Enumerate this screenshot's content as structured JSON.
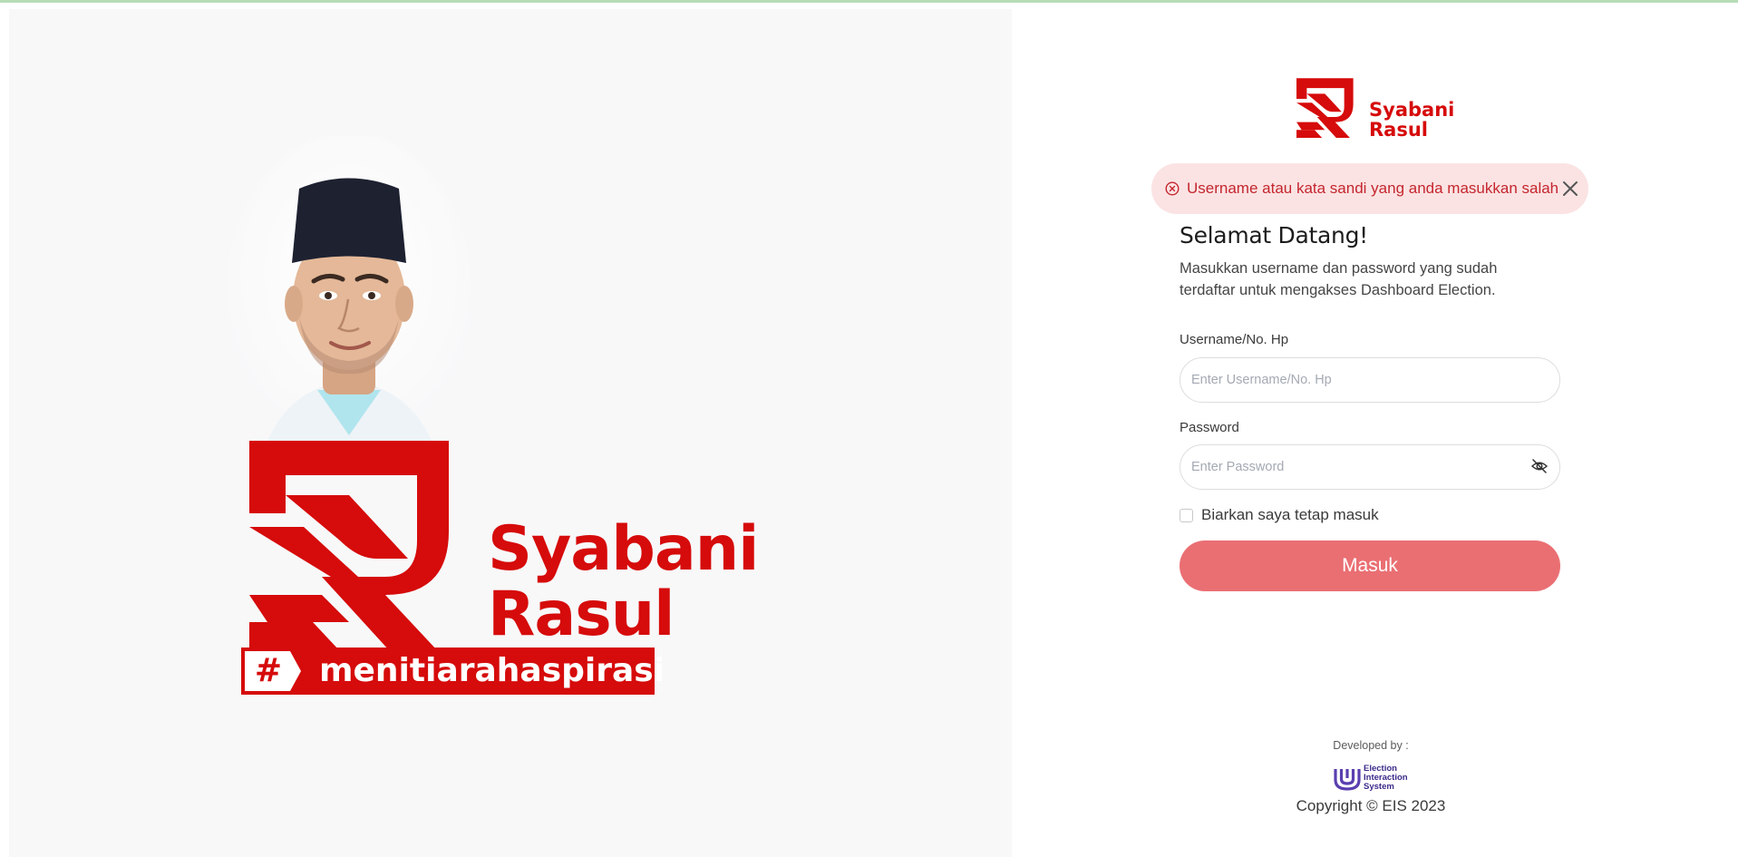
{
  "hero": {
    "name_line1": "Syabani",
    "name_line2": "Rasul",
    "hash_symbol": "#",
    "hashtag": "menitiarahaspirasi",
    "icon": "candidate-portrait"
  },
  "brand": {
    "logo_line1": "Syabani",
    "logo_line2": "Rasul",
    "logo_icon": "sr-monogram-logo",
    "primary_color": "#d60b0b"
  },
  "alert": {
    "message": "Username atau kata sandi yang anda masukkan salah",
    "icon": "error-circle-icon",
    "close_icon": "close-icon",
    "color": "#c4262e",
    "background": "#fbe3e3"
  },
  "welcome": {
    "title": "Selamat Datang!",
    "description": "Masukkan username dan password yang sudah terdaftar untuk mengakses Dashboard Election."
  },
  "form": {
    "username_label": "Username/No. Hp",
    "username_placeholder": "Enter Username/No. Hp",
    "username_value": "",
    "password_label": "Password",
    "password_placeholder": "Enter Password",
    "password_value": "",
    "password_toggle_icon": "eye-off-icon",
    "remember_label": "Biarkan saya tetap masuk",
    "remember_checked": false,
    "submit_label": "Masuk",
    "submit_color": "#ea6f73"
  },
  "footer": {
    "developed_by": "Developed by :",
    "eis_logo_line1": "Election",
    "eis_logo_line2": "Interaction",
    "eis_logo_line3": "System",
    "copyright": "Copyright © EIS 2023"
  }
}
